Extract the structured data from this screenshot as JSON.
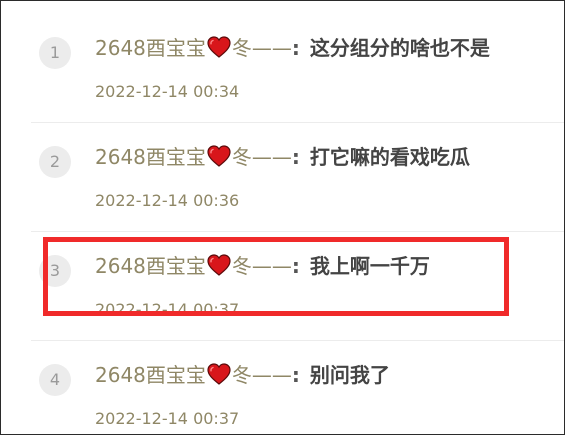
{
  "comments": [
    {
      "rank": "1",
      "author": "2648酉宝宝",
      "author_suffix": "冬——",
      "separator": ":",
      "text": "这分组分的啥也不是",
      "time": "2022-12-14 00:34"
    },
    {
      "rank": "2",
      "author": "2648酉宝宝",
      "author_suffix": "冬——",
      "separator": ":",
      "text": "打它嘛的看戏吃瓜",
      "time": "2022-12-14 00:36"
    },
    {
      "rank": "3",
      "author": "2648酉宝宝",
      "author_suffix": "冬——",
      "separator": ":",
      "text": "我上啊一千万",
      "time": "2022-12-14 00:37"
    },
    {
      "rank": "4",
      "author": "2648酉宝宝",
      "author_suffix": "冬——",
      "separator": ":",
      "text": "别问我了",
      "time": "2022-12-14 00:37"
    }
  ],
  "icons": {
    "heart": "heart-icon"
  },
  "colors": {
    "author": "#8f8766",
    "content": "#444444",
    "rank_bg": "#ececec",
    "highlight": "#f02a2a"
  },
  "highlighted_rank": "3"
}
